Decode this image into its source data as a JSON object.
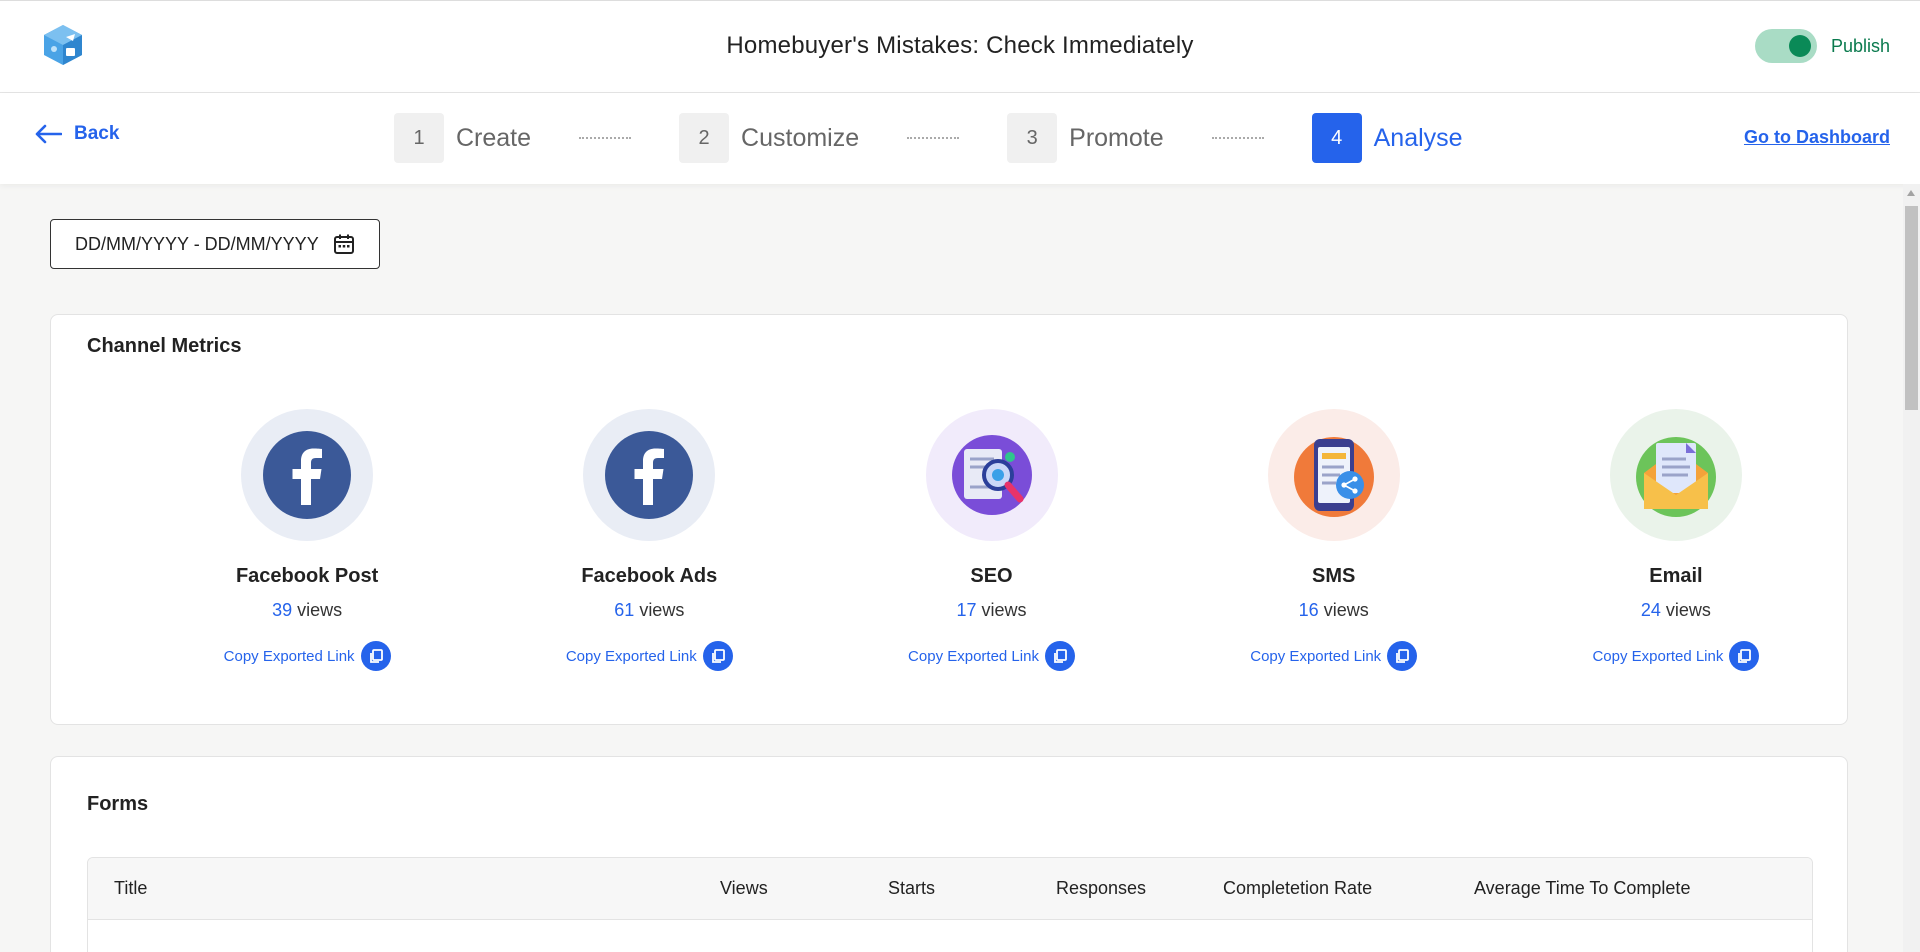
{
  "header": {
    "title": "Homebuyer's Mistakes: Check Immediately",
    "publish_label": "Publish",
    "publish_on": true
  },
  "nav": {
    "back_label": "Back",
    "go_dashboard_label": "Go to Dashboard",
    "steps": [
      {
        "num": "1",
        "label": "Create",
        "active": false
      },
      {
        "num": "2",
        "label": "Customize",
        "active": false
      },
      {
        "num": "3",
        "label": "Promote",
        "active": false
      },
      {
        "num": "4",
        "label": "Analyse",
        "active": true
      }
    ]
  },
  "date_range": {
    "placeholder": "DD/MM/YYYY - DD/MM/YYYY"
  },
  "metrics": {
    "title": "Channel Metrics",
    "channels": [
      {
        "name": "Facebook Post",
        "views": "39",
        "views_label": "views",
        "copy_label": "Copy Exported Link",
        "icon": "facebook-icon",
        "bg": "#e9edf5"
      },
      {
        "name": "Facebook Ads",
        "views": "61",
        "views_label": "views",
        "copy_label": "Copy Exported Link",
        "icon": "facebook-icon",
        "bg": "#e9edf5"
      },
      {
        "name": "SEO",
        "views": "17",
        "views_label": "views",
        "copy_label": "Copy Exported Link",
        "icon": "seo-icon",
        "bg": "#f1ebfb"
      },
      {
        "name": "SMS",
        "views": "16",
        "views_label": "views",
        "copy_label": "Copy Exported Link",
        "icon": "sms-icon",
        "bg": "#fbece8"
      },
      {
        "name": "Email",
        "views": "24",
        "views_label": "views",
        "copy_label": "Copy Exported Link",
        "icon": "email-icon",
        "bg": "#eaf3ea"
      }
    ]
  },
  "forms": {
    "title": "Forms",
    "columns": [
      "Title",
      "Views",
      "Starts",
      "Responses",
      "Completetion Rate",
      "Average Time To Complete"
    ]
  },
  "colors": {
    "accent": "#2563eb",
    "publish_green": "#0a8a57"
  }
}
